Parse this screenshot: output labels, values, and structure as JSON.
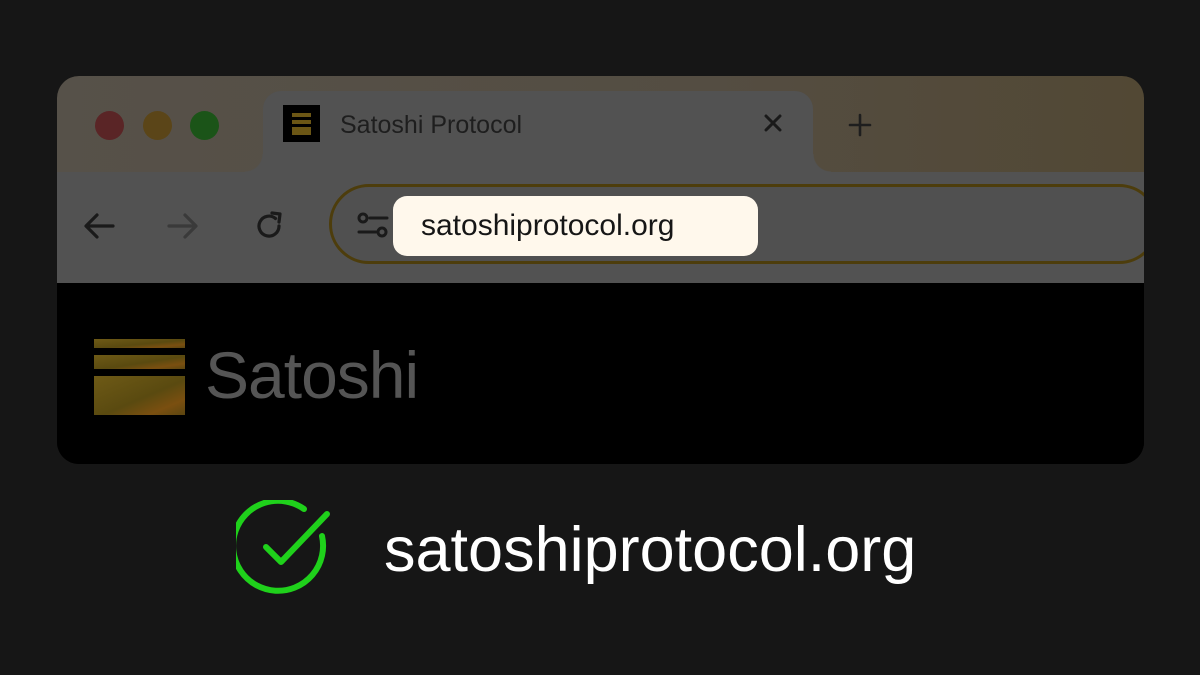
{
  "browser": {
    "traffic_lights": [
      "close",
      "minimize",
      "maximize"
    ],
    "tab": {
      "title": "Satoshi Protocol",
      "favicon": "satoshi-logo-icon",
      "close_icon": "close-icon"
    },
    "new_tab_icon": "plus-icon",
    "toolbar": {
      "back_icon": "arrow-left-icon",
      "forward_icon": "arrow-right-icon",
      "reload_icon": "reload-icon",
      "site_settings_icon": "tune-icon",
      "url": "satoshiprotocol.org"
    }
  },
  "page": {
    "logo_text": "Satoshi"
  },
  "verified": {
    "icon": "check-circle-icon",
    "text": "satoshiprotocol.org",
    "color": "#1fd11b"
  },
  "colors": {
    "background": "#161616",
    "accent": "#e8b51a",
    "url_highlight": "#fff8ec"
  }
}
